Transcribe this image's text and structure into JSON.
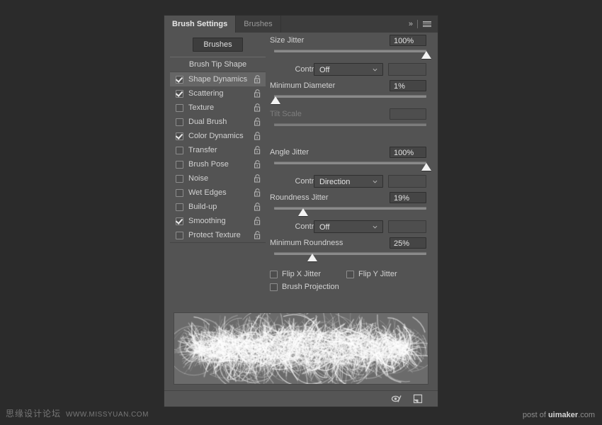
{
  "panel": {
    "tabs": [
      {
        "label": "Brush Settings",
        "active": true
      },
      {
        "label": "Brushes",
        "active": false
      }
    ],
    "collapse_icon": "»",
    "menu_icon": "hamburger-icon",
    "brushes_button": "Brushes"
  },
  "options": {
    "header": "Brush Tip Shape",
    "items": [
      {
        "label": "Shape Dynamics",
        "checked": true,
        "selected": true
      },
      {
        "label": "Scattering",
        "checked": true,
        "selected": false
      },
      {
        "label": "Texture",
        "checked": false,
        "selected": false
      },
      {
        "label": "Dual Brush",
        "checked": false,
        "selected": false
      },
      {
        "label": "Color Dynamics",
        "checked": true,
        "selected": false
      },
      {
        "label": "Transfer",
        "checked": false,
        "selected": false
      },
      {
        "label": "Brush Pose",
        "checked": false,
        "selected": false
      },
      {
        "label": "Noise",
        "checked": false,
        "selected": false
      },
      {
        "label": "Wet Edges",
        "checked": false,
        "selected": false
      },
      {
        "label": "Build-up",
        "checked": false,
        "selected": false
      },
      {
        "label": "Smoothing",
        "checked": true,
        "selected": false
      },
      {
        "label": "Protect Texture",
        "checked": false,
        "selected": false
      }
    ]
  },
  "settings": {
    "size_jitter": {
      "label": "Size Jitter",
      "value": "100%",
      "slider_pct": 100
    },
    "size_control": {
      "label": "Control:",
      "value": "Off",
      "side_value": ""
    },
    "minimum_diameter": {
      "label": "Minimum Diameter",
      "value": "1%",
      "slider_pct": 1
    },
    "tilt_scale": {
      "label": "Tilt Scale",
      "value": "",
      "slider_pct": 0,
      "disabled": true
    },
    "angle_jitter": {
      "label": "Angle Jitter",
      "value": "100%",
      "slider_pct": 100
    },
    "angle_control": {
      "label": "Control:",
      "value": "Direction",
      "side_value": ""
    },
    "roundness_jitter": {
      "label": "Roundness Jitter",
      "value": "19%",
      "slider_pct": 19
    },
    "roundness_control": {
      "label": "Control:",
      "value": "Off",
      "side_value": ""
    },
    "minimum_roundness": {
      "label": "Minimum Roundness",
      "value": "25%",
      "slider_pct": 25
    },
    "flip_x": {
      "label": "Flip X Jitter",
      "checked": false
    },
    "flip_y": {
      "label": "Flip Y Jitter",
      "checked": false
    },
    "brush_projection": {
      "label": "Brush Projection",
      "checked": false
    }
  },
  "footer": {
    "toggle_icon": "brush-preview-toggle-icon",
    "new_brush_icon": "create-new-brush-icon"
  },
  "watermarks": {
    "left_cn": "思缘设计论坛",
    "left_url": "WWW.MISSYUAN.COM",
    "right_prefix": "post of ",
    "right_brand": "uimaker",
    "right_suffix": ".com"
  },
  "colors": {
    "app_bg": "#2b2b2b",
    "panel_bg": "#535353",
    "tabbar_bg": "#3c3c3c",
    "selected_row": "#666666",
    "field_bg": "#454545",
    "slider_track": "#8a8a8a",
    "thumb": "#f2f2f2",
    "preview_bg": "#6b6b6b"
  }
}
